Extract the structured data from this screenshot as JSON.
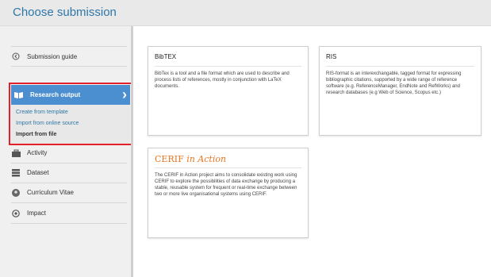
{
  "header": {
    "title": "Choose submission"
  },
  "sidebar": {
    "guide": {
      "label": "Submission guide",
      "icon": "circle-arrow-icon"
    },
    "research": {
      "label": "Research output",
      "icon": "book-icon",
      "subitems": [
        "Create from template",
        "Import from online source",
        "Import from file"
      ]
    },
    "activity": {
      "label": "Activity",
      "icon": "briefcase-icon"
    },
    "dataset": {
      "label": "Dataset",
      "icon": "database-icon"
    },
    "cv": {
      "label": "Curriculum Vitae",
      "icon": "cv-icon"
    },
    "impact": {
      "label": "Impact",
      "icon": "impact-icon"
    }
  },
  "cards": {
    "bibtex": {
      "title": "BibTEX",
      "desc": "BibTex is a tool and a file format which are used to describe and process lists of references, mostly in conjunction with LaTeX documents."
    },
    "ris": {
      "title": "RIS",
      "desc": "RIS-format is an interexchangable, tagged format for expressing bibliographic citations, supported by a wide range of reference software (e.g. ReferenceManager, EndNote and RefWorks) and research databases (e.g Web of Science, Scopus etc.)"
    },
    "cerif": {
      "logo_main": "CERIF",
      "logo_sub": "in Action",
      "desc": "The CERIF in Action project aims to consolidate existing work using CERIF to explore the possibilities of data exchange by producing a stable, reusable system for frequent or real-time exchange between two or more live organisational systems using CERIF."
    }
  },
  "colors": {
    "accent": "#4b8fd0",
    "title": "#2f77a8",
    "highlight": "#e4212a",
    "logo": "#e87722"
  }
}
